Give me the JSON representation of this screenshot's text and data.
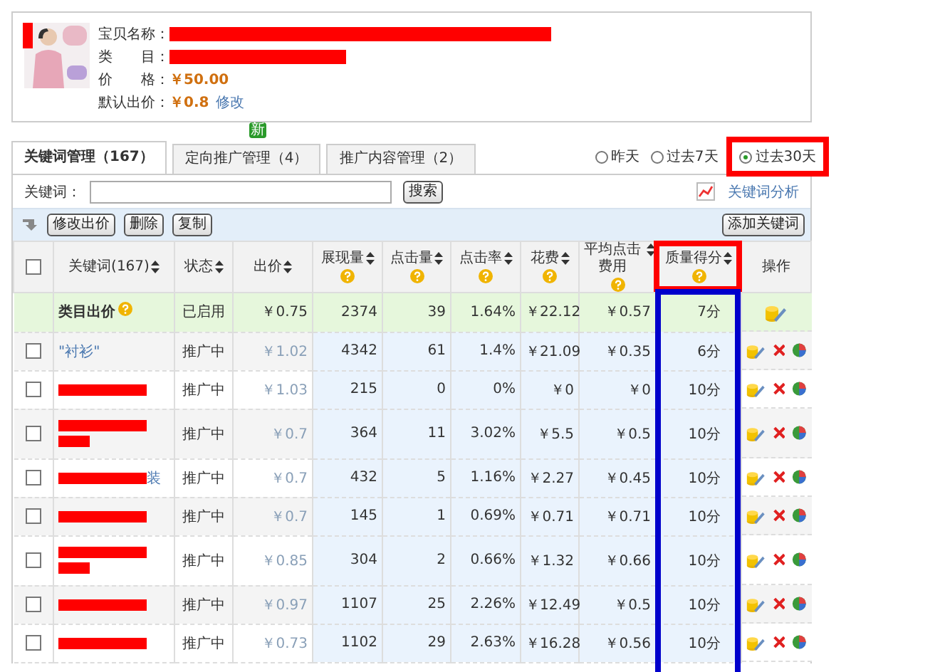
{
  "product": {
    "fields": [
      {
        "label": "宝贝名称：",
        "kind": "redacted"
      },
      {
        "label": "类　　目：",
        "kind": "redacted"
      },
      {
        "label": "价　　格：",
        "kind": "price",
        "value": "￥50.00"
      },
      {
        "label": "默认出价：",
        "kind": "price",
        "value": "￥0.8",
        "link": "修改"
      }
    ]
  },
  "tabs": [
    {
      "label": "关键词管理（167）",
      "selected": true
    },
    {
      "label": "定向推广管理（4）",
      "selected": false,
      "badge": "新"
    },
    {
      "label": "推广内容管理（2）",
      "selected": false
    }
  ],
  "periods": [
    {
      "label": "昨天",
      "selected": false
    },
    {
      "label": "过去7天",
      "selected": false
    },
    {
      "label": "过去30天",
      "selected": true
    }
  ],
  "search": {
    "label": "关键词：",
    "button": "搜索",
    "analysis_link": "关键词分析"
  },
  "toolbar": {
    "buttons": [
      "修改出价",
      "删除",
      "复制"
    ],
    "add_button": "添加关键词"
  },
  "select_all": {
    "checked": false
  },
  "columns": [
    {
      "label": "关键词(167)",
      "sortable": true,
      "help": false
    },
    {
      "label": "状态",
      "sortable": true,
      "help": false
    },
    {
      "label": "出价",
      "sortable": true,
      "help": false
    },
    {
      "label": "展现量",
      "sortable": true,
      "help": true
    },
    {
      "label": "点击量",
      "sortable": true,
      "help": true
    },
    {
      "label": "点击率",
      "sortable": true,
      "help": true
    },
    {
      "label": "花费",
      "sortable": true,
      "help": true
    },
    {
      "label": "平均点击费用",
      "sortable": true,
      "help": true
    },
    {
      "label": "质量得分",
      "sortable": true,
      "help": true
    },
    {
      "label": "操作",
      "sortable": false,
      "help": false
    }
  ],
  "rows": [
    {
      "kind": "category",
      "keyword": "类目出价",
      "status": "已启用",
      "bid": "￥0.75",
      "impressions": "2374",
      "clicks": "39",
      "ctr": "1.64%",
      "cost": "￥22.12",
      "avg_cpc": "￥0.57",
      "quality": "7分"
    },
    {
      "kind": "keyword",
      "checked": false,
      "keyword": "\"衬衫\"",
      "status": "推广中",
      "bid": "￥1.02",
      "impressions": "4342",
      "clicks": "61",
      "ctr": "1.4%",
      "cost": "￥21.09",
      "avg_cpc": "￥0.35",
      "quality": "6分"
    },
    {
      "kind": "masked",
      "checked": false,
      "status": "推广中",
      "bid": "￥1.03",
      "impressions": "215",
      "clicks": "0",
      "ctr": "0%",
      "cost": "￥0",
      "avg_cpc": "￥0",
      "quality": "10分"
    },
    {
      "kind": "masked_tall",
      "checked": false,
      "status": "推广中",
      "bid": "￥0.7",
      "impressions": "364",
      "clicks": "11",
      "ctr": "3.02%",
      "cost": "￥5.5",
      "avg_cpc": "￥0.5",
      "quality": "10分"
    },
    {
      "kind": "masked",
      "checked": false,
      "keyword": "装",
      "status": "推广中",
      "bid": "￥0.7",
      "impressions": "432",
      "clicks": "5",
      "ctr": "1.16%",
      "cost": "￥2.27",
      "avg_cpc": "￥0.45",
      "quality": "10分"
    },
    {
      "kind": "masked",
      "checked": false,
      "status": "推广中",
      "bid": "￥0.7",
      "impressions": "145",
      "clicks": "1",
      "ctr": "0.69%",
      "cost": "￥0.71",
      "avg_cpc": "￥0.71",
      "quality": "10分"
    },
    {
      "kind": "masked_tall",
      "checked": false,
      "status": "推广中",
      "bid": "￥0.85",
      "impressions": "304",
      "clicks": "2",
      "ctr": "0.66%",
      "cost": "￥1.32",
      "avg_cpc": "￥0.66",
      "quality": "10分"
    },
    {
      "kind": "masked",
      "checked": false,
      "status": "推广中",
      "bid": "￥0.97",
      "impressions": "1107",
      "clicks": "25",
      "ctr": "2.26%",
      "cost": "￥12.49",
      "avg_cpc": "￥0.5",
      "quality": "10分"
    },
    {
      "kind": "masked",
      "checked": false,
      "status": "推广中",
      "bid": "￥0.73",
      "impressions": "1102",
      "clicks": "29",
      "ctr": "2.63%",
      "cost": "￥16.28",
      "avg_cpc": "￥0.56",
      "quality": "10分"
    }
  ],
  "annotations": [
    {
      "kind": "period_frame",
      "color": "#ff0000"
    },
    {
      "kind": "header_frame",
      "color": "#ff0000"
    },
    {
      "kind": "column_frame",
      "color": "#0000cc"
    }
  ]
}
